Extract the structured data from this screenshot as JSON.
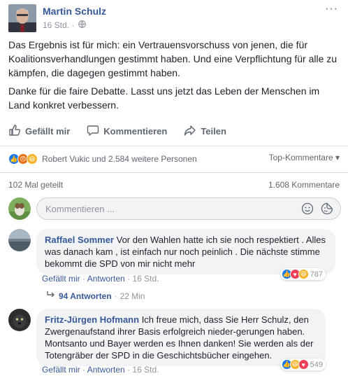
{
  "post": {
    "author": "Martin Schulz",
    "time": "16 Std. ·",
    "more": "···",
    "paragraphs": [
      "Das Ergebnis ist für mich: ein Vertrauensvorschuss von jenen, die für Koalitionsverhandlungen gestimmt haben. Und eine Verpflichtung für alle zu kämpfen, die dagegen gestimmt haben.",
      "Danke für die faire Debatte. Lasst uns jetzt das Leben der Menschen im Land konkret verbessern."
    ]
  },
  "actions": {
    "like": "Gefällt mir",
    "comment": "Kommentieren",
    "share": "Teilen"
  },
  "reactions": {
    "summary": "Robert Vukic und 2.584 weitere Personen",
    "sort": "Top-Kommentare ▾"
  },
  "stats": {
    "shares": "102 Mal geteilt",
    "comments": "1.608 Kommentare"
  },
  "composer": {
    "placeholder": "Kommentieren ..."
  },
  "comments": [
    {
      "name": "Raffael Sommer",
      "text": "Vor den Wahlen hatte ich sie noch respektiert . Alles was danach kam , ist einfach nur noch peinlich . Die nächste stimme bekommt die SPD von mir nicht mehr",
      "like": "Gefällt mir",
      "reply": "Antworten",
      "time": "16 Std.",
      "reaction_count": "787"
    },
    {
      "name": "Fritz-Jürgen Hofmann",
      "text": "Ich freue mich, dass Sie Herr Schulz, den Zwergenaufstand ihrer Basis erfolgreich nieder-gerungen haben. Montsanto und Bayer werden es Ihnen danken! Sie werden als der Totengräber der SPD in die Geschichtsbücher eingehen.",
      "like": "Gefällt mir",
      "reply": "Antworten",
      "time": "16 Std.",
      "reaction_count": "549"
    }
  ],
  "replies": {
    "label": "94 Antworten",
    "time": "22 Min"
  },
  "colors": {
    "link": "#365899",
    "like": "#1877f2",
    "angry": "#e9710f",
    "haha": "#f7b125",
    "love": "#f33e58"
  }
}
